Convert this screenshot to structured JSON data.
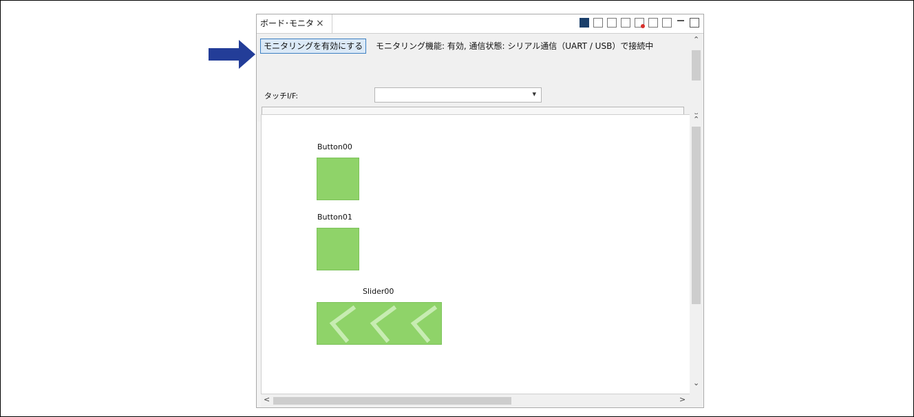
{
  "panel": {
    "tab_title": "ボード･モニタ",
    "close_glyph": "×"
  },
  "toolbar": {
    "icons": [
      "panel-icon",
      "export-icon",
      "save-icon",
      "import-icon",
      "record-icon",
      "blank-icon",
      "grid-icon",
      "minimize-icon",
      "maximize-icon"
    ]
  },
  "monitor": {
    "enable_button_label": "モニタリングを有効にする",
    "status_text": "モニタリング機能: 有効, 通信状態: シリアル通信（UART / USB）で接続中",
    "touch_if_label": "タッチI/F:",
    "touch_if_value": ""
  },
  "canvas": {
    "button00_label": "Button00",
    "button01_label": "Button01",
    "slider00_label": "Slider00"
  },
  "colors": {
    "widget_green": "#8fd369",
    "arrow_blue": "#233d98",
    "button_highlight": "#dbe9f7"
  },
  "scroll": {
    "up_glyph": "⌃",
    "down_glyph": "⌄",
    "left_glyph": "<",
    "right_glyph": ">"
  }
}
